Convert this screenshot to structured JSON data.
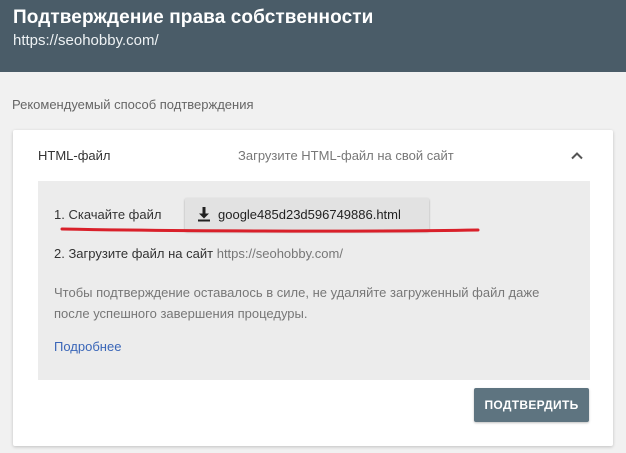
{
  "header": {
    "title": "Подтверждение права собственности",
    "url": "https://seohobby.com/"
  },
  "section_label": "Рекомендуемый способ подтверждения",
  "method": {
    "name": "HTML-файл",
    "description": "Загрузите HTML-файл на свой сайт",
    "expanded": true
  },
  "steps": {
    "step1_label": "1. Скачайте файл",
    "download_filename": "google485d23d596749886.html",
    "step2_label": "2. Загрузите файл на сайт",
    "step2_site": "https://seohobby.com/"
  },
  "note": "Чтобы подтверждение оставалось в силе, не удаляйте загруженный файл даже после успешного завершения процедуры.",
  "more_link": "Подробнее",
  "confirm_button": "ПОДТВЕРДИТЬ",
  "colors": {
    "header_bg": "#4a5c68",
    "link": "#3a66b8",
    "button_bg": "#5e7480",
    "annotation_underline": "#d9202a"
  }
}
